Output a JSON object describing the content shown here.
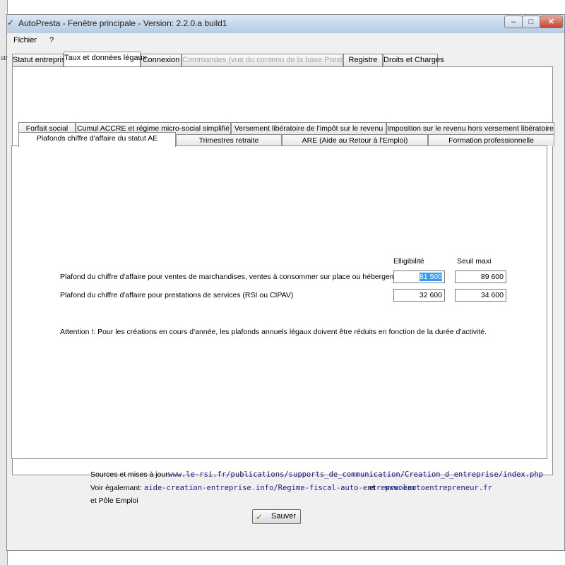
{
  "window": {
    "title": "AutoPresta - Fenêtre principale  -  Version: 2.2.0.a build1",
    "sidebar_edge_text": "str"
  },
  "menu": [
    "Fichier",
    "?"
  ],
  "top_tabs": [
    {
      "label": "Statut entreprise",
      "state": "normal"
    },
    {
      "label": "Taux et données légaux",
      "state": "active"
    },
    {
      "label": "Connexion",
      "state": "normal"
    },
    {
      "label": "Commandes (vue du contenu de la base Prestashop)",
      "state": "disabled"
    },
    {
      "label": "Registre",
      "state": "normal"
    },
    {
      "label": "Droits et Charges",
      "state": "normal"
    }
  ],
  "inner_tabs_row1": [
    "Forfait social",
    "Cumul ACCRE et régime micro-social simplifié",
    "Versement libératoire de l'impôt sur le revenu",
    "Imposition sur le revenu hors versement libératoire"
  ],
  "inner_tabs_row2": [
    "Plafonds chiffre d'affaire du statut AE",
    "Trimestres retraite",
    "ARE (Aide au Retour à l'Emploi)",
    "Formation professionnelle"
  ],
  "plafonds": {
    "col_eligibilite": "Elligibilité",
    "col_seuil": "Seuil maxi",
    "row1_label": "Plafond du chiffre d'affaire pour ventes de marchandises, ventes à consommer sur place ou hébergement  (RSI)",
    "row1_eligibilite": "81 500",
    "row1_seuil": "89 600",
    "row2_label": "Plafond du chiffre d'affaire pour prestations de services (RSI ou CIPAV)",
    "row2_eligibilite": "32 600",
    "row2_seuil": "34 600",
    "warning": "Attention !: Pour les créations en cours d'année, les plafonds annuels légaux doivent être réduits en fonction de la durée d'activité."
  },
  "footer": {
    "sources_label": "Sources et mises à jour:",
    "sources_link": "www.le-rsi.fr/publications/supports_de_communication/Creation_d_entreprise/index.php",
    "voir_label": "Voir égalemant:",
    "voir_link1": "aide-creation-entreprise.info/Regime-fiscal-auto-entrepreneur",
    "et": "et",
    "voir_link2": "www.lautoentrepreneur.fr",
    "pole_emploi": "et Pôle Emploi",
    "save_label": "Sauver"
  },
  "icons": {
    "save": "check-icon",
    "minimize": "minimize-icon",
    "maximize": "maximize-icon",
    "close": "close-icon"
  }
}
